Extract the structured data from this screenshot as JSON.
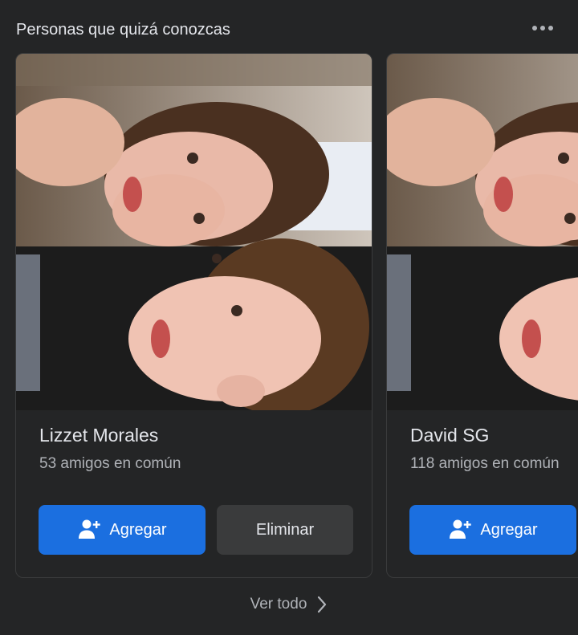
{
  "section": {
    "title": "Personas que quizá conozcas",
    "more_icon": "more-options-icon"
  },
  "cards": [
    {
      "name": "Lizzet Morales",
      "mutual_friends": "53 amigos en común",
      "add_label": "Agregar",
      "remove_label": "Eliminar",
      "photo": "profile-photo"
    },
    {
      "name": "David SG",
      "mutual_friends": "118 amigos en común",
      "add_label": "Agregar",
      "photo": "profile-photo"
    }
  ],
  "footer": {
    "see_all_label": "Ver todo",
    "see_all_icon": "chevron-right-icon"
  },
  "colors": {
    "background": "#242526",
    "primary_button": "#1b6fe0",
    "secondary_button": "#3a3b3c",
    "text_primary": "#e4e6eb",
    "text_secondary": "#b0b3b8"
  }
}
